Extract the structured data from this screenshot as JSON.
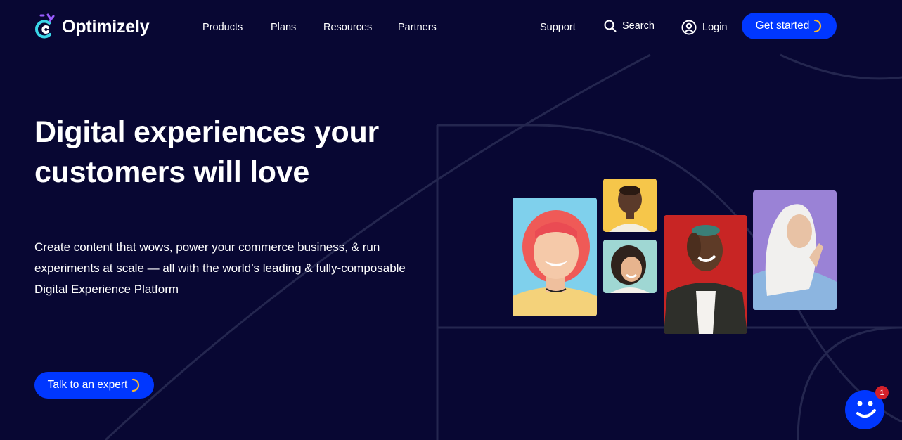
{
  "brand": {
    "name": "Optimizely"
  },
  "nav": {
    "links": [
      "Products",
      "Plans",
      "Resources",
      "Partners"
    ],
    "support": "Support",
    "search": "Search",
    "login": "Login",
    "cta": "Get started"
  },
  "hero": {
    "title": "Digital experiences your customers will love",
    "subtitle": "Create content that wows, power your commerce business, & run experiments at scale — all with the world’s leading & fully-composable Digital Experience Platform",
    "cta": "Talk to an expert"
  },
  "chat": {
    "badge_count": "1"
  },
  "colors": {
    "background": "#080733",
    "accent": "#0037ff",
    "badge": "#d4202a",
    "spinner": "#f5b731"
  }
}
